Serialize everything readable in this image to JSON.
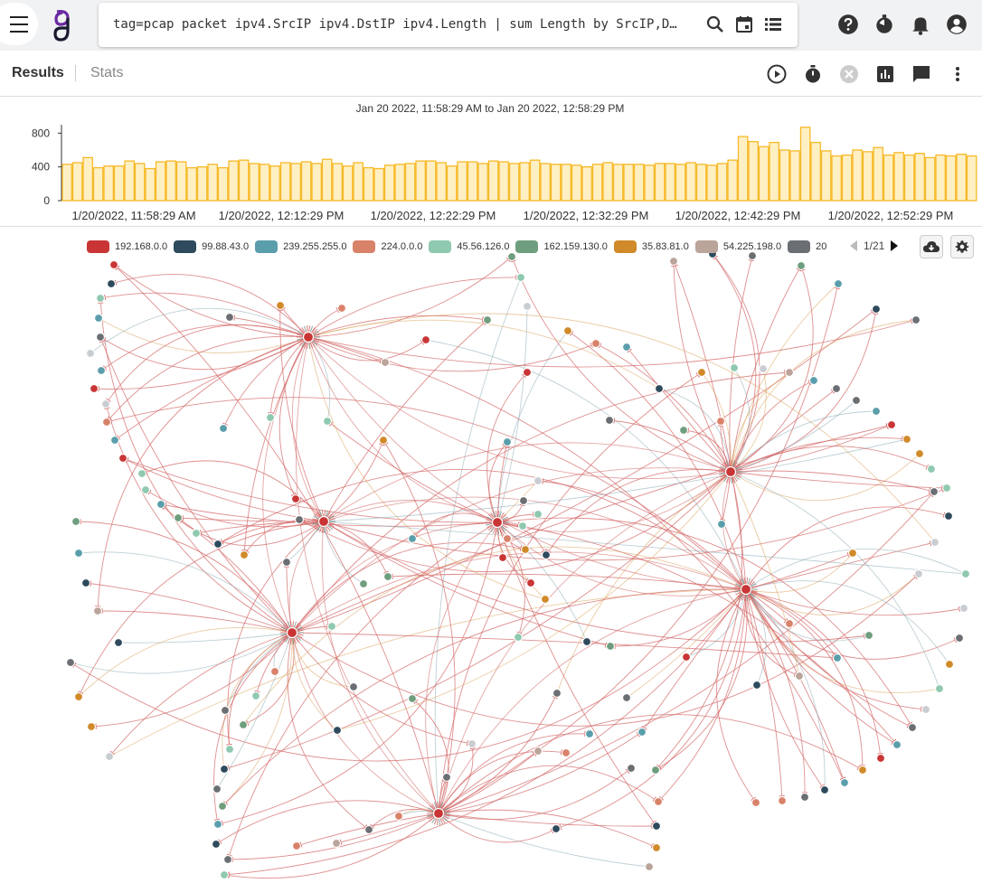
{
  "search": {
    "query": "tag=pcap packet ipv4.SrcIP ipv4.DstIP ipv4.Length | sum Length by SrcIP,DstIP | force SrcIP DstIP"
  },
  "tabs": {
    "results": "Results",
    "stats": "Stats"
  },
  "timerange": "Jan 20 2022, 11:58:29 AM to Jan 20 2022, 12:58:29 PM",
  "legend": {
    "items": [
      {
        "label": "192.168.0.0",
        "color": "#c93535"
      },
      {
        "label": "99.88.43.0",
        "color": "#2e4a5c"
      },
      {
        "label": "239.255.255.0",
        "color": "#5b9eab"
      },
      {
        "label": "224.0.0.0",
        "color": "#d9826a"
      },
      {
        "label": "45.56.126.0",
        "color": "#8fc9b0"
      },
      {
        "label": "162.159.130.0",
        "color": "#6f9e7e"
      },
      {
        "label": "35.83.81.0",
        "color": "#d08a2a"
      },
      {
        "label": "54.225.198.0",
        "color": "#bba49a"
      },
      {
        "label": "20",
        "color": "#6b6f73"
      }
    ],
    "page": "1/21"
  },
  "icons": {
    "topbar": [
      "menu-icon",
      "gravwell-logo",
      "search-icon",
      "calendar-icon",
      "list-icon",
      "help-icon",
      "timer-icon",
      "bell-icon",
      "account-icon"
    ],
    "actions": [
      "play-icon",
      "stopwatch-icon",
      "cancel-icon",
      "chart-icon",
      "comment-icon",
      "more-vert-icon"
    ],
    "graph": [
      "cloud-download-icon",
      "gear-icon"
    ]
  },
  "colors": {
    "bar_fill": "#fff0c4",
    "bar_stroke": "#f7b928",
    "topbar_bg": "#f1f2f4"
  },
  "chart_data": {
    "type": "bar",
    "title": "",
    "xlabel": "",
    "ylabel": "",
    "ylim": [
      0,
      900
    ],
    "yticks": [
      0,
      400,
      800
    ],
    "xtick_labels": [
      "1/20/2022, 11:58:29 AM",
      "1/20/2022, 12:12:29 PM",
      "1/20/2022, 12:22:29 PM",
      "1/20/2022, 12:32:29 PM",
      "1/20/2022, 12:42:29 PM",
      "1/20/2022, 12:52:29 PM"
    ],
    "values": [
      430,
      450,
      510,
      390,
      410,
      410,
      470,
      440,
      380,
      460,
      470,
      460,
      390,
      400,
      430,
      390,
      470,
      480,
      440,
      430,
      410,
      450,
      440,
      460,
      440,
      490,
      440,
      410,
      450,
      390,
      380,
      420,
      430,
      440,
      470,
      470,
      450,
      410,
      460,
      460,
      440,
      470,
      460,
      440,
      450,
      480,
      440,
      430,
      430,
      420,
      400,
      430,
      450,
      430,
      430,
      430,
      420,
      440,
      440,
      430,
      450,
      430,
      420,
      440,
      480,
      760,
      700,
      640,
      690,
      600,
      590,
      870,
      690,
      590,
      530,
      540,
      600,
      580,
      630,
      540,
      570,
      540,
      560,
      510,
      540,
      530,
      550,
      530
    ]
  }
}
